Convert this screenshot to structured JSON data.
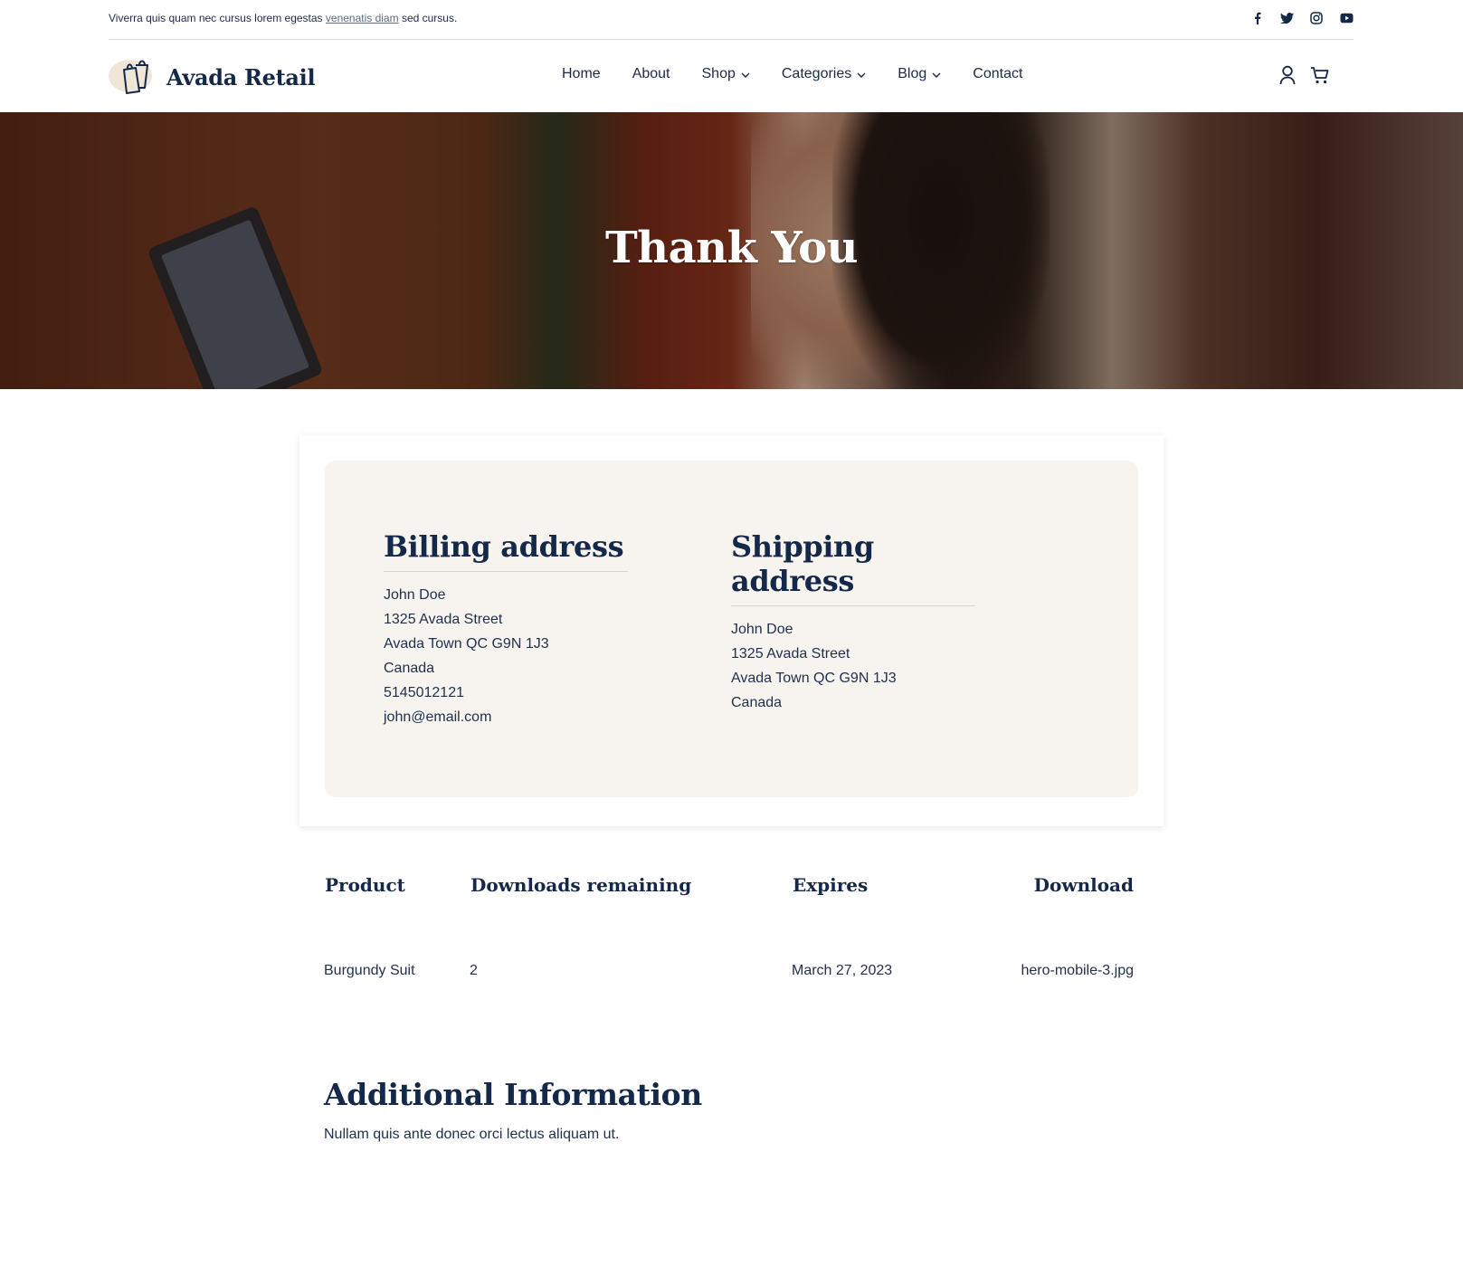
{
  "topbar": {
    "message_before": "Viverra quis quam nec cursus lorem egestas ",
    "message_link": "venenatis diam",
    "message_after": " sed cursus.",
    "social_icons": [
      "facebook-icon",
      "twitter-icon",
      "instagram-icon",
      "youtube-icon"
    ]
  },
  "header": {
    "brand": "Avada Retail",
    "nav": [
      {
        "label": "Home",
        "has_dropdown": false
      },
      {
        "label": "About",
        "has_dropdown": false
      },
      {
        "label": "Shop",
        "has_dropdown": true
      },
      {
        "label": "Categories",
        "has_dropdown": true
      },
      {
        "label": "Blog",
        "has_dropdown": true
      },
      {
        "label": "Contact",
        "has_dropdown": false
      }
    ],
    "icons": [
      "user-icon",
      "cart-icon"
    ]
  },
  "hero": {
    "title": "Thank You"
  },
  "billing": {
    "title": "Billing address",
    "lines": [
      "John Doe",
      "1325 Avada Street",
      "Avada Town QC G9N 1J3",
      "Canada",
      "5145012121",
      "john@email.com"
    ]
  },
  "shipping": {
    "title": "Shipping address",
    "lines": [
      "John Doe",
      "1325 Avada Street",
      "Avada Town QC G9N 1J3",
      "Canada"
    ]
  },
  "downloads": {
    "headers": [
      "Product",
      "Downloads remaining",
      "Expires",
      "Download"
    ],
    "rows": [
      [
        "Burgundy Suit",
        "2",
        "March 27, 2023",
        "hero-mobile-3.jpg"
      ]
    ]
  },
  "additional": {
    "title": "Additional Information",
    "text": "Nullam quis ante donec orci lectus aliquam ut."
  },
  "colors": {
    "navy": "#142849",
    "card_bg": "#f7f4ef",
    "logo_blob": "#efe6d8"
  }
}
